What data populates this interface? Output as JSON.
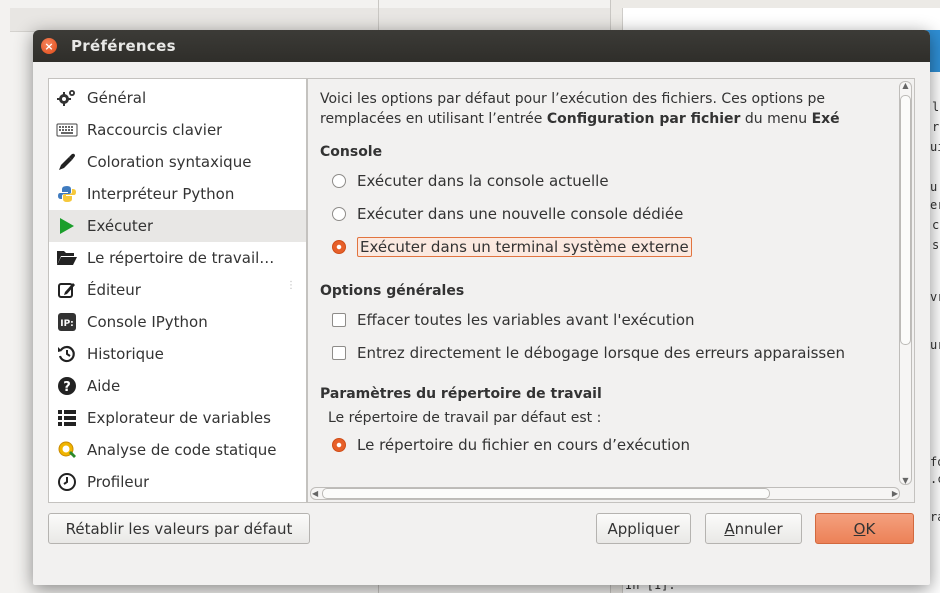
{
  "background": {
    "fragments": [
      "l",
      "r",
      "ui",
      "u",
      "er",
      "c",
      "s",
      "vr",
      "ur",
      "fo",
      ".c",
      "ra",
      "In [1]:"
    ]
  },
  "dialog": {
    "title": "Préférences",
    "sidebar": {
      "items": [
        {
          "label": "Général",
          "icon": "gears-icon"
        },
        {
          "label": "Raccourcis clavier",
          "icon": "keyboard-icon"
        },
        {
          "label": "Coloration syntaxique",
          "icon": "eyedropper-icon"
        },
        {
          "label": "Interpréteur Python",
          "icon": "python-icon"
        },
        {
          "label": "Exécuter",
          "icon": "play-icon",
          "selected": true
        },
        {
          "label": "Le répertoire de travail…",
          "icon": "folder-open-icon"
        },
        {
          "label": "Éditeur",
          "icon": "edit-icon"
        },
        {
          "label": "Console IPython",
          "icon": "ipython-icon"
        },
        {
          "label": "Historique",
          "icon": "history-icon"
        },
        {
          "label": "Aide",
          "icon": "help-icon"
        },
        {
          "label": "Explorateur de variables",
          "icon": "list-icon"
        },
        {
          "label": "Analyse de code statique",
          "icon": "code-analysis-icon"
        },
        {
          "label": "Profileur",
          "icon": "clock-icon"
        }
      ]
    },
    "content": {
      "intro_line1": "Voici les options par défaut pour l’exécution des fichiers. Ces options pe",
      "intro_line2_pre": "remplacées en utilisant l’entrée ",
      "intro_line2_bold": "Configuration par fichier",
      "intro_line2_mid": " du menu ",
      "intro_line2_bold2": "Exé",
      "console": {
        "title": "Console",
        "options": [
          {
            "label": "Exécuter dans la console actuelle",
            "checked": false
          },
          {
            "label": "Exécuter dans une nouvelle console dédiée",
            "checked": false
          },
          {
            "label": "Exécuter dans un terminal système externe",
            "checked": true
          }
        ]
      },
      "general": {
        "title": "Options générales",
        "options": [
          {
            "label": "Effacer toutes les variables avant l'exécution",
            "checked": false
          },
          {
            "label": "Entrez directement le débogage lorsque des erreurs apparaissen",
            "checked": false
          }
        ]
      },
      "workdir": {
        "title": "Paramètres du répertoire de travail",
        "subtitle": "Le répertoire de travail par défaut est :",
        "option": {
          "label": "Le répertoire du fichier en cours d’exécution",
          "checked": true
        }
      }
    },
    "buttons": {
      "reset": "Rétablir les valeurs par défaut",
      "apply": "Appliquer",
      "cancel_prefix": "",
      "cancel_mnemonic": "A",
      "cancel_rest": "nnuler",
      "ok_mnemonic": "O",
      "ok_rest": "K"
    },
    "accent_color": "#e9622a"
  }
}
